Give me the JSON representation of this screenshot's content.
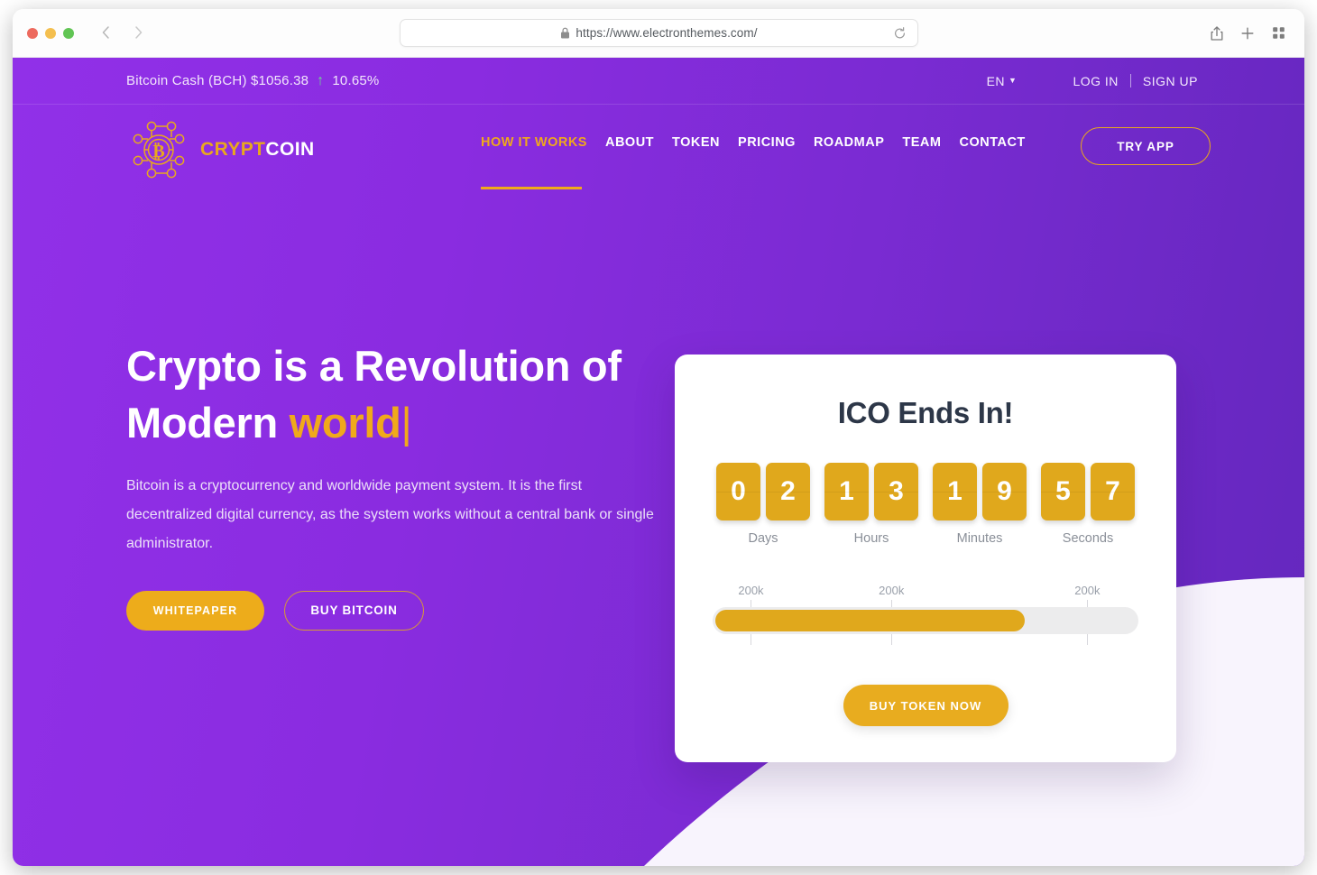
{
  "browser": {
    "url": "https://www.electronthemes.com/",
    "lock_icon": "lock-icon",
    "back_icon": "chevron-left-icon",
    "forward_icon": "chevron-right-icon",
    "reload_icon": "reload-icon",
    "share_icon": "share-icon",
    "new_tab_icon": "plus-icon",
    "tab_overview_icon": "grid-icon"
  },
  "ticker": {
    "coin": "Bitcoin Cash (BCH) $1056.38",
    "direction_icon": "arrow-up-icon",
    "change": "10.65%",
    "language": "EN",
    "caret": "▼",
    "log_in": "LOG IN",
    "sign_up": "SIGN UP",
    "accent_green": "#6edb8f"
  },
  "header": {
    "logo_primary": "CRYPT",
    "logo_secondary": "COIN",
    "logo_icon": "bitcoin-network-icon",
    "nav": [
      {
        "label": "HOW IT WORKS",
        "active": true
      },
      {
        "label": "ABOUT",
        "active": false
      },
      {
        "label": "TOKEN",
        "active": false
      },
      {
        "label": "PRICING",
        "active": false
      },
      {
        "label": "ROADMAP",
        "active": false
      },
      {
        "label": "TEAM",
        "active": false
      },
      {
        "label": "CONTACT",
        "active": false
      }
    ],
    "try_app": "TRY APP",
    "accent_gold": "#f0a91b"
  },
  "hero": {
    "title_line1": "Crypto is a Revolution of",
    "title_line2_plain": "Modern ",
    "title_line2_accent": "world",
    "cursor": "|",
    "description": "Bitcoin is a cryptocurrency and worldwide payment system. It is the first decentralized digital currency, as the system works without a central bank or single administrator.",
    "btn_whitepaper": "WHITEPAPER",
    "btn_buy_bitcoin": "BUY BITCOIN"
  },
  "ico": {
    "title": "ICO Ends In!",
    "countdown": [
      {
        "label": "Days",
        "d1": "0",
        "d2": "2"
      },
      {
        "label": "Hours",
        "d1": "1",
        "d2": "3"
      },
      {
        "label": "Minutes",
        "d1": "1",
        "d2": "9"
      },
      {
        "label": "Seconds",
        "d1": "5",
        "d2": "7"
      }
    ],
    "progress": {
      "fill_percent": "74",
      "ticks": [
        {
          "label": "200k",
          "position_percent": "9"
        },
        {
          "label": "200k",
          "position_percent": "42"
        },
        {
          "label": "200k",
          "position_percent": "88"
        }
      ]
    },
    "buy_token": "BUY TOKEN NOW"
  },
  "theme": {
    "purple_left": "#9130e8",
    "purple_right": "#6327bd",
    "gold": "#e0a81c",
    "card_bg": "#ffffff",
    "lavender_shape": "#f8f4fd"
  }
}
